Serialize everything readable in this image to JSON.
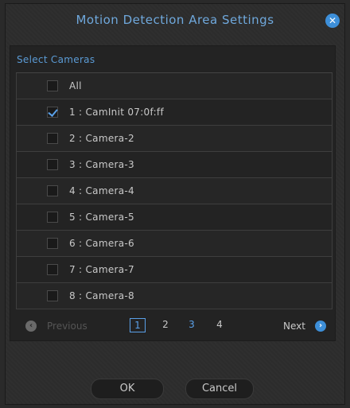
{
  "dialog": {
    "title": "Motion Detection Area Settings",
    "close_icon": "close-icon",
    "close_glyph": "✕"
  },
  "cameras": {
    "section_label": "Select Cameras",
    "items": [
      {
        "label": "All",
        "checked": false
      },
      {
        "label": "1 : CamInit 07:0f:ff",
        "checked": true
      },
      {
        "label": "2 : Camera-2",
        "checked": false
      },
      {
        "label": "3 : Camera-3",
        "checked": false
      },
      {
        "label": "4 : Camera-4",
        "checked": false
      },
      {
        "label": "5 : Camera-5",
        "checked": false
      },
      {
        "label": "6 : Camera-6",
        "checked": false
      },
      {
        "label": "7 : Camera-7",
        "checked": false
      },
      {
        "label": "8 : Camera-8",
        "checked": false
      }
    ]
  },
  "pager": {
    "previous_label": "Previous",
    "next_label": "Next",
    "prev_glyph": "‹",
    "next_glyph": "›",
    "pages": [
      "1",
      "2",
      "3",
      "4"
    ],
    "current_page": "1"
  },
  "buttons": {
    "ok_label": "OK",
    "cancel_label": "Cancel"
  },
  "colors": {
    "accent": "#3d8fd9",
    "title": "#6fa8dc",
    "background": "#2c2c2c"
  }
}
